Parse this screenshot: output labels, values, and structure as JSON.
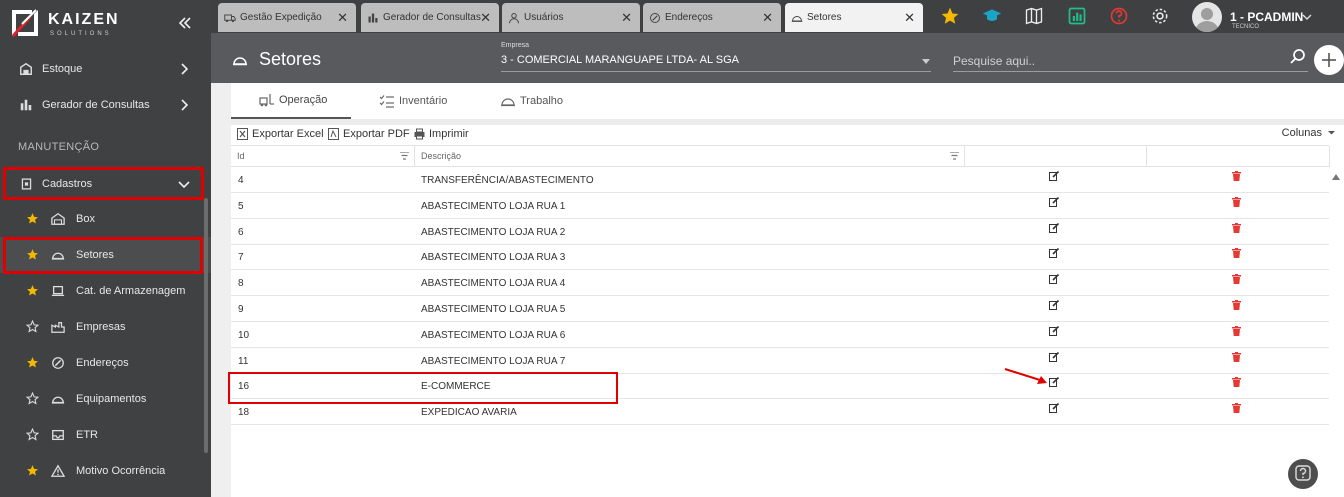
{
  "brand": {
    "name": "KAIZEN",
    "sub": "SOLUTIONS"
  },
  "colors": {
    "sidebar_bg": "#404142",
    "header_bg": "#585a5e",
    "highlight": "#e00000",
    "star": "#f5b800",
    "delete": "#e53935"
  },
  "sidebar": {
    "top_items": [
      {
        "label": "Estoque",
        "icon": "box-icon"
      },
      {
        "label": "Gerador de Consultas",
        "icon": "chart-bars-icon"
      }
    ],
    "section": "MANUTENÇÃO",
    "group": {
      "label": "Cadastros",
      "icon": "document-icon",
      "expanded": true
    },
    "sub_items": [
      {
        "label": "Box",
        "icon": "warehouse-icon",
        "starred": true
      },
      {
        "label": "Setores",
        "icon": "hardhat-icon",
        "starred": true,
        "active": true
      },
      {
        "label": "Cat. de Armazenagem",
        "icon": "pallet-icon",
        "starred": true
      },
      {
        "label": "Empresas",
        "icon": "factory-icon",
        "starred": false
      },
      {
        "label": "Endereços",
        "icon": "compass-icon",
        "starred": true
      },
      {
        "label": "Equipamentos",
        "icon": "hardhat-icon",
        "starred": false
      },
      {
        "label": "ETR",
        "icon": "inbox-icon",
        "starred": false
      },
      {
        "label": "Motivo Ocorrência",
        "icon": "warning-icon",
        "starred": true
      }
    ]
  },
  "tabs": [
    {
      "label": "Gestão Expedição",
      "icon": "truck-icon"
    },
    {
      "label": "Gerador de Consultas",
      "icon": "chart-bars-icon"
    },
    {
      "label": "Usuários",
      "icon": "user-icon"
    },
    {
      "label": "Endereços",
      "icon": "compass-icon"
    },
    {
      "label": "Setores",
      "icon": "hardhat-icon",
      "active": true
    }
  ],
  "user": {
    "name": "1 - PCADMIN",
    "role": "TECNICO"
  },
  "header": {
    "title": "Setores",
    "empresa_label": "Empresa",
    "empresa_value": "3 - COMERCIAL MARANGUAPE LTDA- AL SGA",
    "search_placeholder": "Pesquise aqui.."
  },
  "subtabs": [
    {
      "label": "Operação",
      "icon": "forklift-icon",
      "active": true
    },
    {
      "label": "Inventário",
      "icon": "checklist-icon"
    },
    {
      "label": "Trabalho",
      "icon": "hardhat-icon"
    }
  ],
  "toolbar": {
    "excel": "Exportar Excel",
    "pdf": "Exportar PDF",
    "print": "Imprimir",
    "columns": "Colunas"
  },
  "grid": {
    "columns": [
      "Id",
      "Descrição"
    ],
    "rows": [
      {
        "id": "4",
        "desc": "TRANSFERÊNCIA/ABASTECIMENTO"
      },
      {
        "id": "5",
        "desc": "ABASTECIMENTO LOJA RUA 1"
      },
      {
        "id": "6",
        "desc": "ABASTECIMENTO LOJA RUA 2"
      },
      {
        "id": "7",
        "desc": "ABASTECIMENTO LOJA RUA 3"
      },
      {
        "id": "8",
        "desc": "ABASTECIMENTO LOJA RUA 4"
      },
      {
        "id": "9",
        "desc": "ABASTECIMENTO LOJA RUA 5"
      },
      {
        "id": "10",
        "desc": "ABASTECIMENTO LOJA RUA 6"
      },
      {
        "id": "11",
        "desc": "ABASTECIMENTO LOJA RUA 7"
      },
      {
        "id": "16",
        "desc": "E-COMMERCE"
      },
      {
        "id": "18",
        "desc": "EXPEDICAO AVARIA"
      }
    ]
  }
}
